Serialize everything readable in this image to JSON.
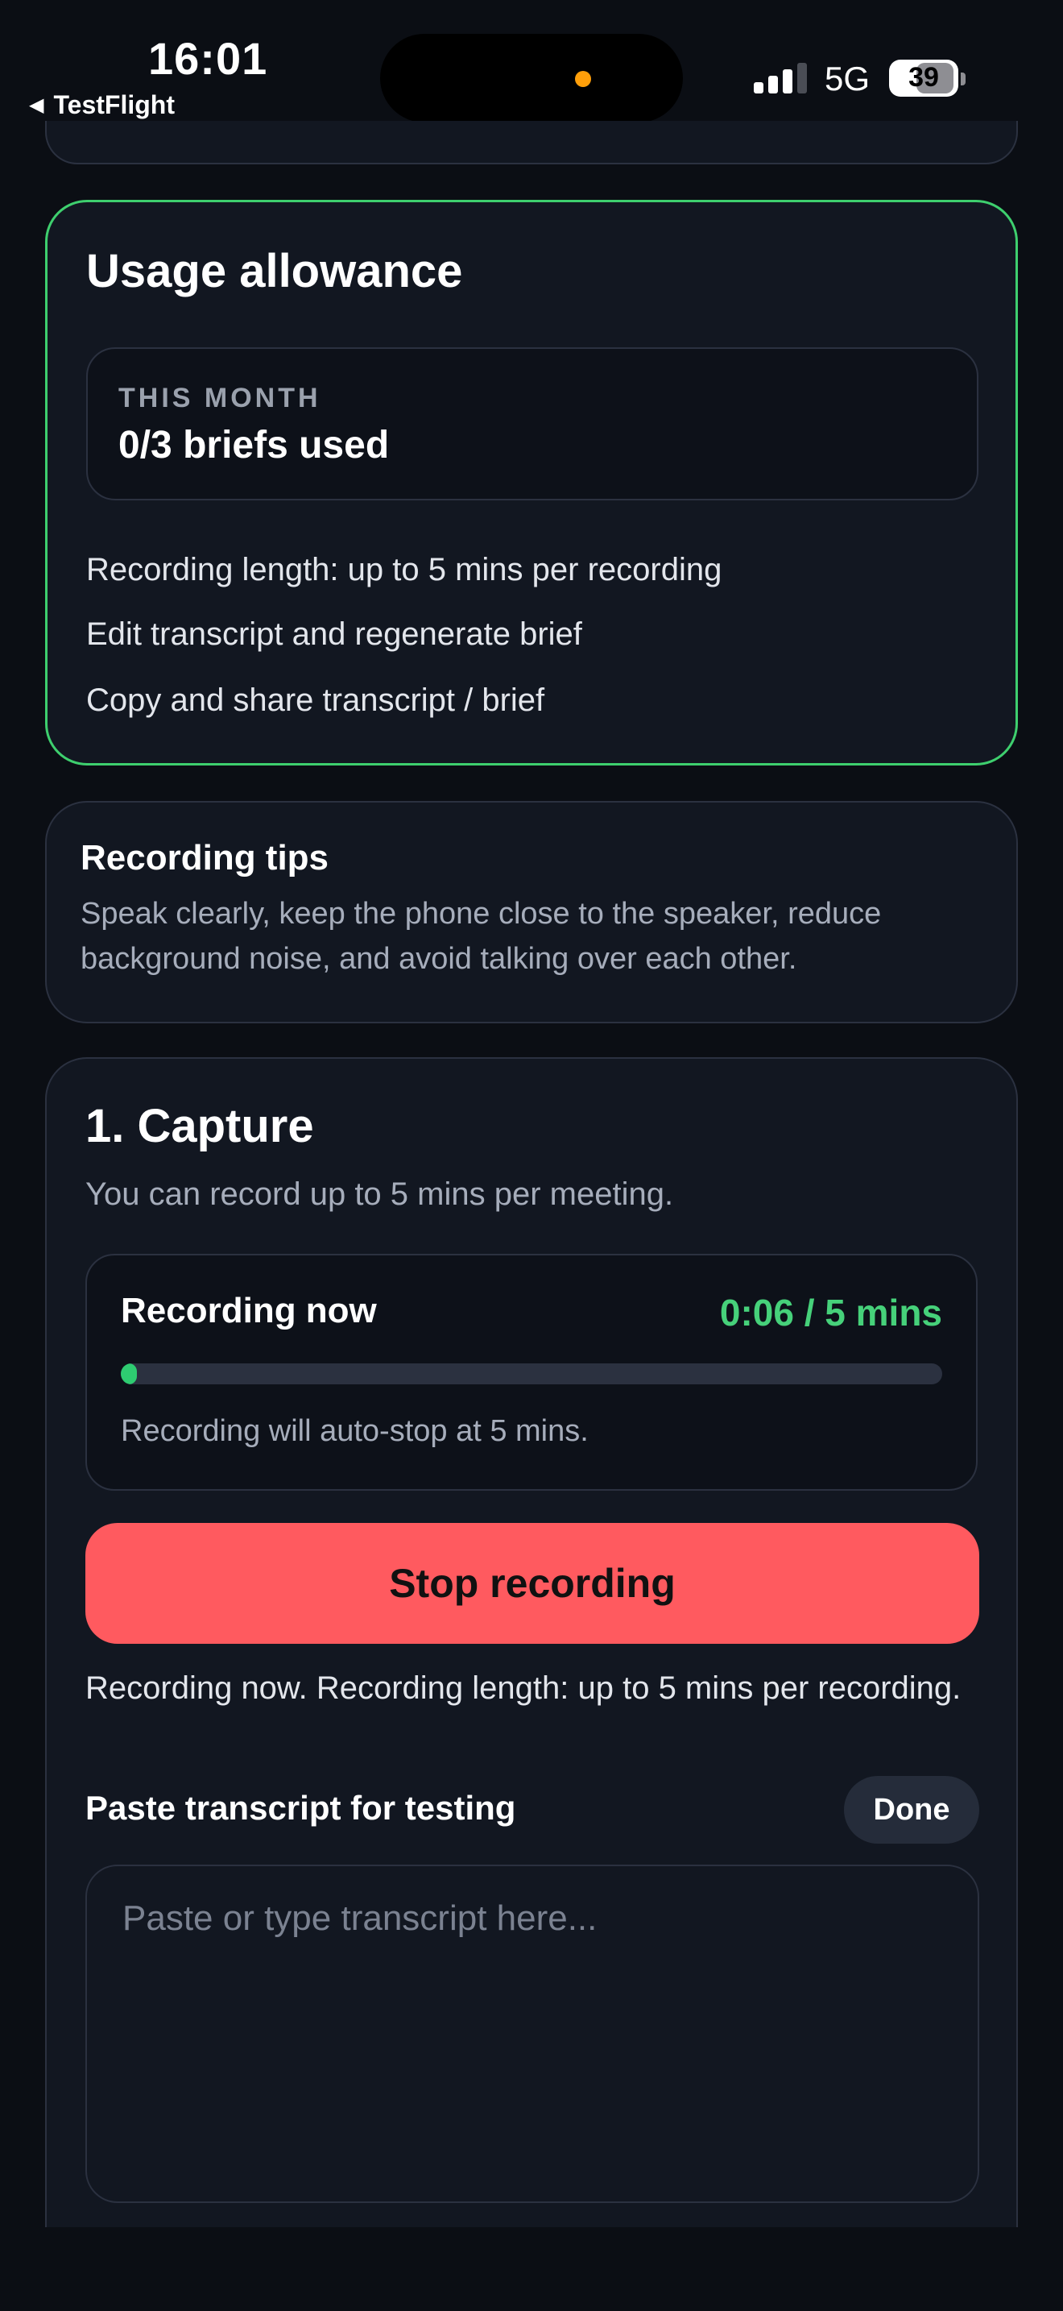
{
  "status_bar": {
    "time": "16:01",
    "back_app": "TestFlight",
    "network": "5G",
    "battery": "39",
    "battery_level": 0.39
  },
  "usage": {
    "title": "Usage allowance",
    "period_label": "THIS MONTH",
    "briefs_used": "0/3 briefs used",
    "features": [
      "Recording length: up to 5 mins per recording",
      "Edit transcript and regenerate brief",
      "Copy and share transcript / brief"
    ],
    "accent": "#3ecf6e"
  },
  "tips": {
    "title": "Recording tips",
    "body": "Speak clearly, keep the phone close to the speaker, reduce background noise, and avoid talking over each other."
  },
  "capture": {
    "title": "1. Capture",
    "subtitle": "You can record up to 5 mins per meeting.",
    "recording_label": "Recording now",
    "timer": "0:06 / 5 mins",
    "progress": 0.02,
    "auto_stop_note": "Recording will auto-stop at 5 mins.",
    "stop_button": "Stop recording",
    "status_text": "Recording now. Recording length: up to 5 mins per recording.",
    "paste_label": "Paste transcript for testing",
    "done_button": "Done",
    "transcript_placeholder": "Paste or type transcript here...",
    "transcript_value": "",
    "stop_color": "#ff5a5f",
    "timer_color": "#46d17a"
  }
}
